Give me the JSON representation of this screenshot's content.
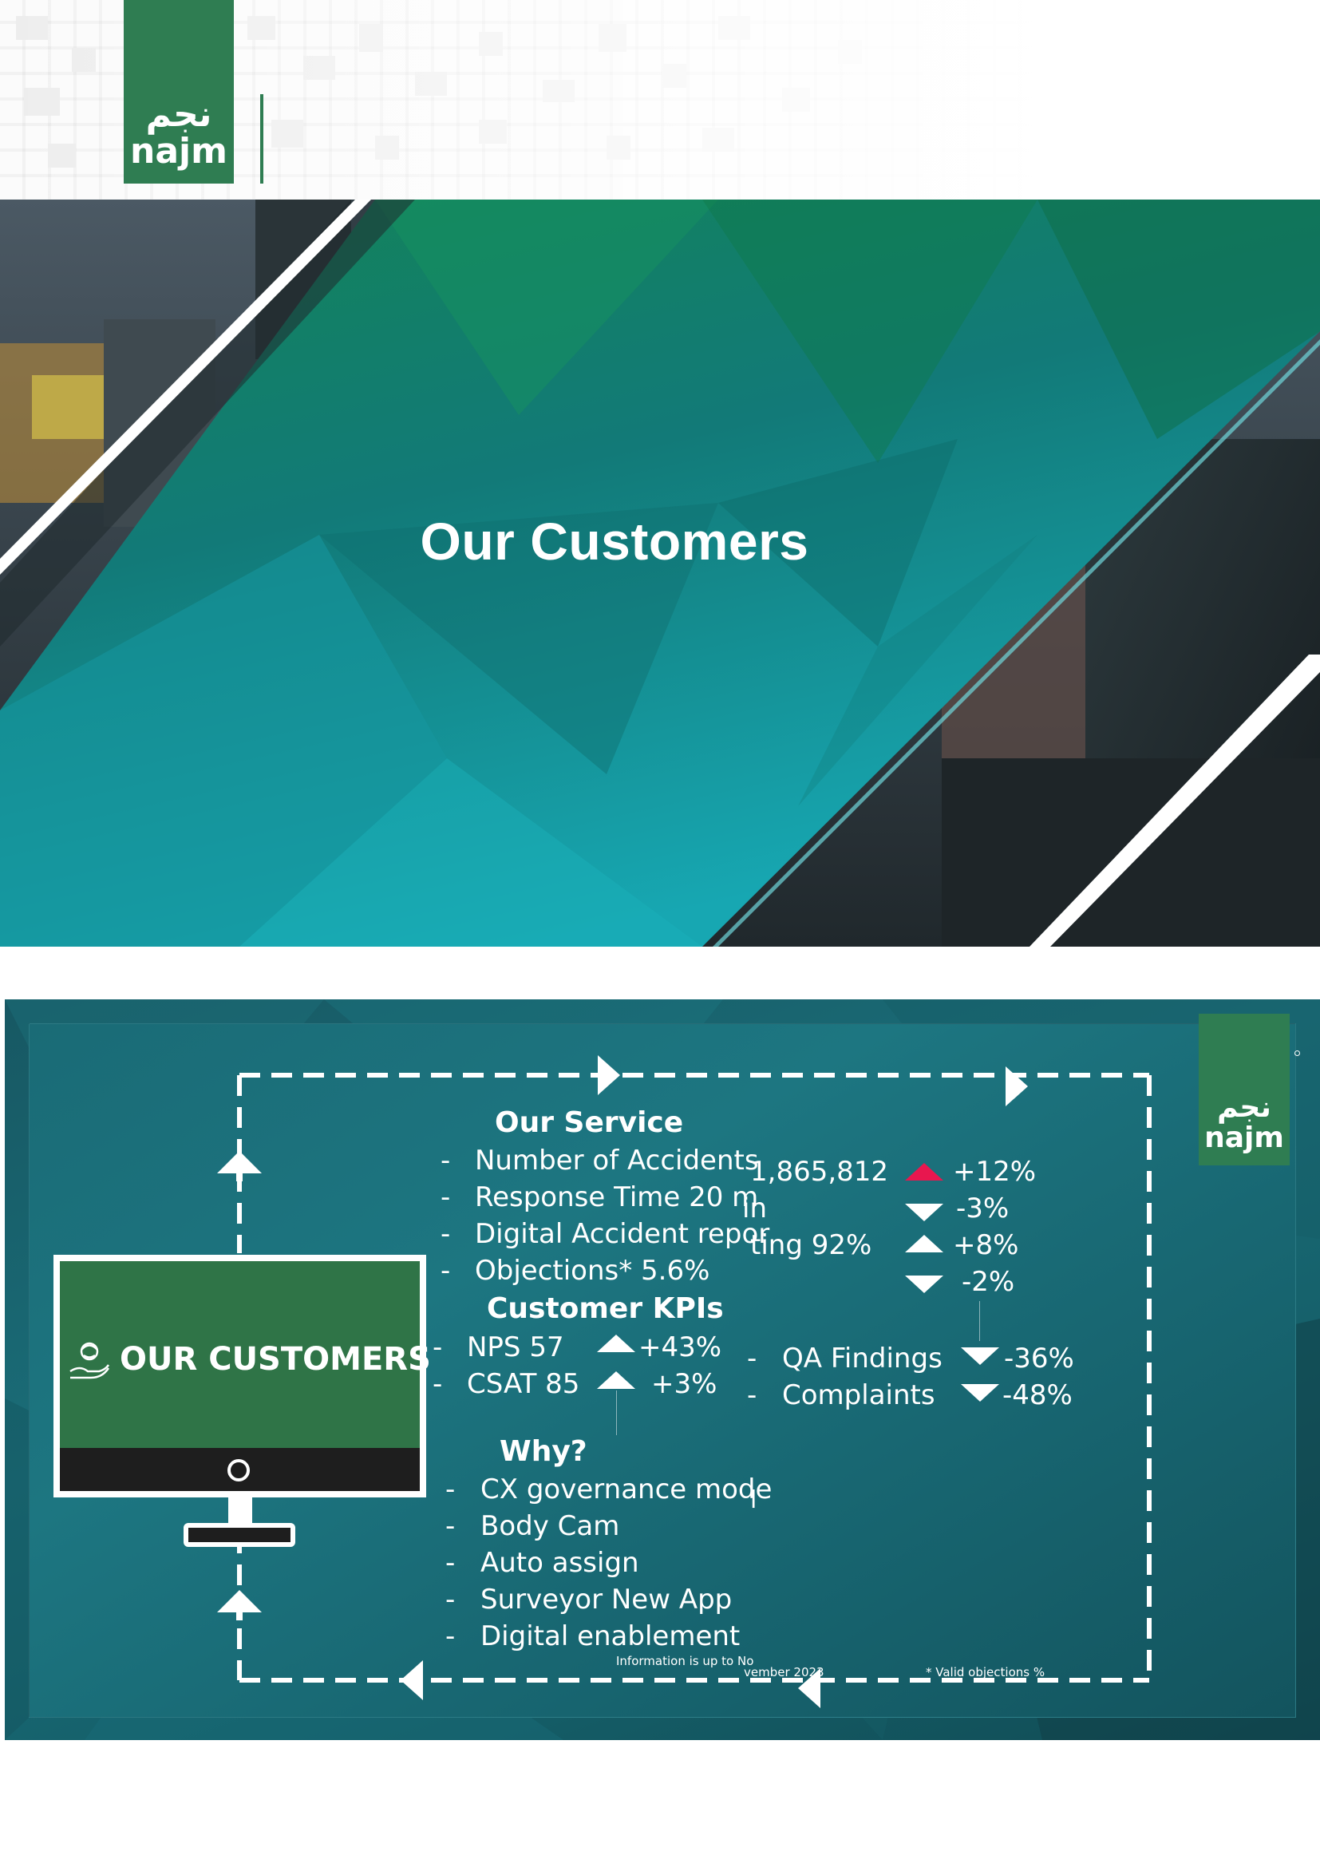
{
  "header": {
    "logo": {
      "arabic": "نجم",
      "english": "najm"
    }
  },
  "cover": {
    "title": "Our Customers"
  },
  "slide": {
    "logo": {
      "arabic": "نجم",
      "english": "najm"
    },
    "monitor_label": "OUR CUSTOMERS",
    "service": {
      "heading": "Our Service",
      "items": [
        {
          "dash": "-",
          "label": "Number of Accidents",
          "value": "1,865,812",
          "change": "+12%",
          "direction": "up",
          "arrow_color": "#e8174f"
        },
        {
          "dash": "-",
          "label": "Response Time 20 m",
          "value": "in",
          "change": "-3%",
          "direction": "down",
          "arrow_color": "#ffffff"
        },
        {
          "dash": "-",
          "label": "Digital Accident repor",
          "value": "ting 92%",
          "change": "+8%",
          "direction": "up",
          "arrow_color": "#ffffff"
        },
        {
          "dash": "-",
          "label": "Objections*  5.6%",
          "value": "",
          "change": "-2%",
          "direction": "down",
          "arrow_color": "#ffffff"
        }
      ]
    },
    "kpis": {
      "heading": "Customer KPIs",
      "left": [
        {
          "dash": "-",
          "label": "NPS 57",
          "change": "+43%",
          "direction": "up"
        },
        {
          "dash": "-",
          "label": "CSAT 85",
          "change": "+3%",
          "direction": "up"
        }
      ],
      "right": [
        {
          "dash": "-",
          "label": "QA Findings",
          "change": "-36%",
          "direction": "down"
        },
        {
          "dash": "-",
          "label": "Complaints",
          "change": "-48%",
          "direction": "down"
        }
      ]
    },
    "why": {
      "heading": "Why?",
      "items": [
        {
          "dash": "-",
          "label": "CX governance mode",
          "tail": "l"
        },
        {
          "dash": "-",
          "label": "Body Cam",
          "tail": ""
        },
        {
          "dash": "-",
          "label": "Auto assign",
          "tail": ""
        },
        {
          "dash": "-",
          "label": "Surveyor New App",
          "tail": ""
        },
        {
          "dash": "-",
          "label": "Digital enablement",
          "tail": ""
        }
      ]
    },
    "notes": {
      "info_part1": "Information is up to No",
      "info_part2": "vember 2023",
      "valid": "* Valid objections %"
    },
    "icons": [
      "arrow-right-icon",
      "arrow-up-icon",
      "arrow-left-icon",
      "arrow-down-icon",
      "customer-care-icon",
      "monitor-power-icon"
    ],
    "colors": {
      "brand_green": "#2f7d52",
      "teal": "#1a6b76",
      "alert_red": "#e8174f"
    }
  }
}
